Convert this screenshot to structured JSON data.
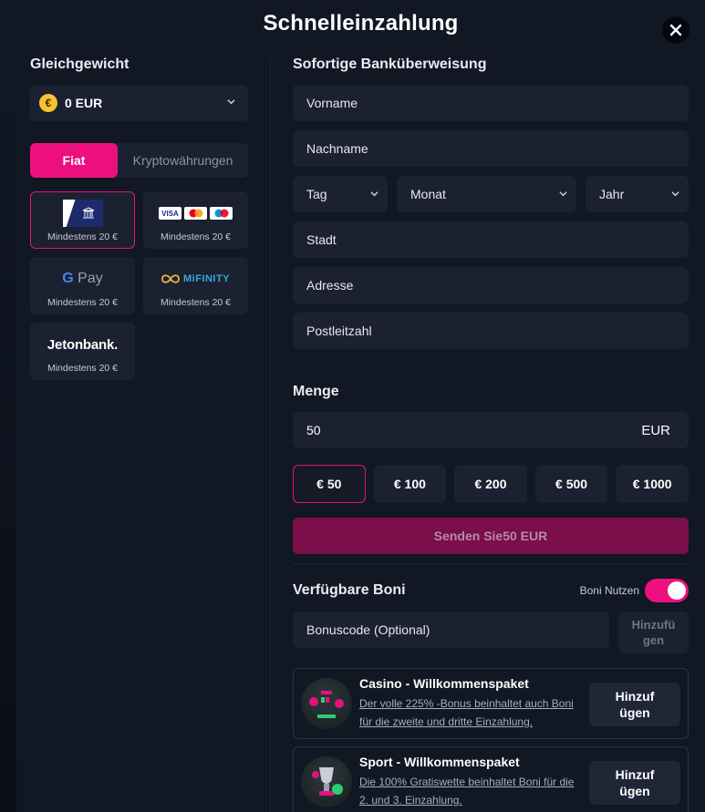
{
  "modal": {
    "title": "Schnelleinzahlung"
  },
  "balance": {
    "label": "Gleichgewicht",
    "currency_symbol": "€",
    "value": "0 EUR"
  },
  "tabs": [
    {
      "label": "Fiat",
      "active": true
    },
    {
      "label": "Kryptowährungen",
      "active": false
    }
  ],
  "payment_methods": [
    {
      "name": "bank-transfer",
      "min": "Mindestens 20 €",
      "selected": true
    },
    {
      "name": "cards",
      "min": "Mindestens 20 €",
      "logo": [
        "VISA",
        "MC",
        "Maestro"
      ]
    },
    {
      "name": "google-pay",
      "min": "Mindestens 20 €",
      "logo_text": "Pay",
      "logo_g": "G"
    },
    {
      "name": "mifinity",
      "min": "Mindestens 20 €",
      "logo_text": "MiFINITY"
    },
    {
      "name": "jetonbank",
      "min": "Mindestens 20 €",
      "logo_text": "Jetonbank."
    }
  ],
  "form": {
    "title": "Sofortige Banküberweisung",
    "first_name": "Vorname",
    "last_name": "Nachname",
    "day": "Tag",
    "month": "Monat",
    "year": "Jahr",
    "city": "Stadt",
    "address": "Adresse",
    "postcode": "Postleitzahl"
  },
  "amount": {
    "label": "Menge",
    "value": "50",
    "currency": "EUR",
    "quick": [
      "€ 50",
      "€ 100",
      "€ 200",
      "€ 500",
      "€ 1000"
    ],
    "selected_index": 0,
    "send_label": "Senden Sie50 EUR"
  },
  "bonuses": {
    "title": "Verfügbare Boni",
    "toggle_label": "Boni Nutzen",
    "toggle_on": true,
    "code_placeholder": "Bonuscode (Optional)",
    "add_label_1": "Hinzufü",
    "add_label_2": "gen",
    "offers": [
      {
        "title": "Casino - Willkommenspaket",
        "desc": "Der volle 225% -Bonus beinhaltet auch Boni für die zweite und dritte Einzahlung.",
        "btn1": "Hinzuf",
        "btn2": "ügen"
      },
      {
        "title": "Sport - Willkommenspaket",
        "desc": "Die 100% Gratiswette beinhaltet Boni für die 2. und 3. Einzahlung.",
        "btn1": "Hinzuf",
        "btn2": "ügen"
      }
    ]
  },
  "colors": {
    "accent": "#ee0f7e",
    "panel": "#111723",
    "field": "#1b2130"
  }
}
